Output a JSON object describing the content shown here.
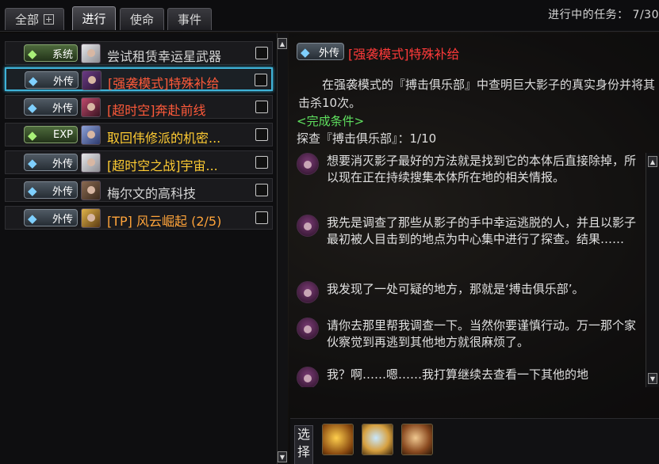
{
  "tabs": {
    "all": "全部",
    "in_progress": "进行",
    "mission": "使命",
    "event": "事件"
  },
  "task_count": {
    "label": "进行中的任务：",
    "value": "7/30"
  },
  "quests": [
    {
      "badge": "系统",
      "title": "尝试租赁幸运星武器",
      "color": "white"
    },
    {
      "badge": "外传",
      "title": "[强袭模式]特殊补给",
      "color": "red"
    },
    {
      "badge": "外传",
      "title": "[超时空]奔赴前线",
      "color": "red"
    },
    {
      "badge": "EXP",
      "title": "取回伟修派的机密...",
      "color": "gold"
    },
    {
      "badge": "外传",
      "title": "[超时空之战]宇宙...",
      "color": "gold"
    },
    {
      "badge": "外传",
      "title": "梅尔文的高科技",
      "color": "white"
    },
    {
      "badge": "外传",
      "title": "[TP] 风云崛起 (2/5)",
      "color": "orange"
    }
  ],
  "detail": {
    "badge": "外传",
    "title": "[强袭模式]特殊补给",
    "description": "在强袭模式的『搏击俱乐部』中查明巨大影子的真实身份并将其击杀10次。",
    "condition_label": "<完成条件>",
    "condition_text": "探查『搏击俱乐部』：1/10"
  },
  "dialog": [
    "想要消灭影子最好的方法就是找到它的本体后直接除掉，所以现在正在持续搜集本体所在地的相关情报。",
    "我先是调查了那些从影子的手中幸运逃脱的人，并且以影子最初被人目击到的地点为中心集中进行了探查。结果……",
    "我发现了一处可疑的地方，那就是‘搏击俱乐部’。",
    "请你去那里帮我调查一下。当然你要谨慎行动。万一那个家伙察觉到再逃到其他地方就很麻烦了。",
    "我？啊……嗯……我打算继续去查看一下其他的地"
  ],
  "select": {
    "label": "选择"
  }
}
